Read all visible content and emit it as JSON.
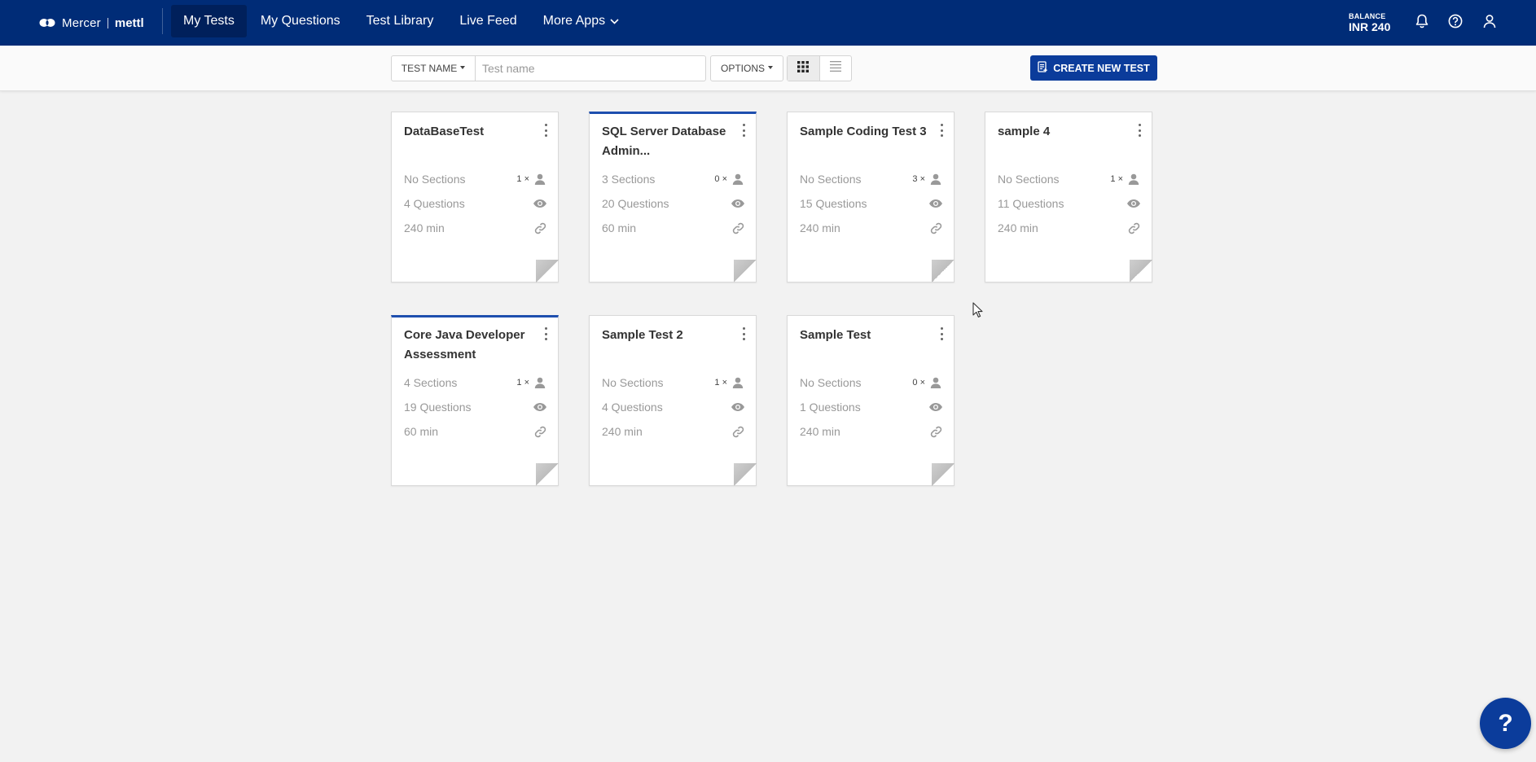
{
  "brand": {
    "company": "Mercer",
    "product": "mettl"
  },
  "nav": {
    "items": [
      {
        "label": "My Tests",
        "active": true
      },
      {
        "label": "My Questions",
        "active": false
      },
      {
        "label": "Test Library",
        "active": false
      },
      {
        "label": "Live Feed",
        "active": false
      },
      {
        "label": "More Apps",
        "active": false
      }
    ]
  },
  "account": {
    "balance_label": "BALANCE",
    "balance_value": "INR 240",
    "icons": [
      "bell-icon",
      "help-circle-icon",
      "user-icon"
    ]
  },
  "toolbar": {
    "filter_label": "TEST NAME",
    "search_value": "",
    "search_placeholder": "Test name",
    "options_label": "OPTIONS",
    "view_modes": [
      "grid-view-icon",
      "list-view-icon"
    ],
    "active_view": "grid",
    "create_label": "CREATE NEW TEST"
  },
  "tests": [
    {
      "title": "DataBaseTest",
      "sections": "No Sections",
      "questions": "4 Questions",
      "duration": "240 min",
      "candidates": "1 ×",
      "accent": false
    },
    {
      "title": "SQL Server Database Admin...",
      "sections": "3 Sections",
      "questions": "20 Questions",
      "duration": "60 min",
      "candidates": "0 ×",
      "accent": true
    },
    {
      "title": "Sample Coding Test 3",
      "sections": "No Sections",
      "questions": "15 Questions",
      "duration": "240 min",
      "candidates": "3 ×",
      "accent": false
    },
    {
      "title": "sample 4",
      "sections": "No Sections",
      "questions": "11 Questions",
      "duration": "240 min",
      "candidates": "1 ×",
      "accent": false
    },
    {
      "title": "Core Java Developer Assessment",
      "sections": "4 Sections",
      "questions": "19 Questions",
      "duration": "60 min",
      "candidates": "1 ×",
      "accent": true
    },
    {
      "title": "Sample Test 2",
      "sections": "No Sections",
      "questions": "4 Questions",
      "duration": "240 min",
      "candidates": "1 ×",
      "accent": false
    },
    {
      "title": "Sample Test",
      "sections": "No Sections",
      "questions": "1 Questions",
      "duration": "240 min",
      "candidates": "0 ×",
      "accent": false
    }
  ],
  "help": {
    "label": "?"
  },
  "colors": {
    "nav_bg": "#002c77",
    "nav_active": "#00205b",
    "primary_button": "#0b3c9b",
    "card_accent": "#1e4fae",
    "page_bg": "#f2f2f2"
  }
}
